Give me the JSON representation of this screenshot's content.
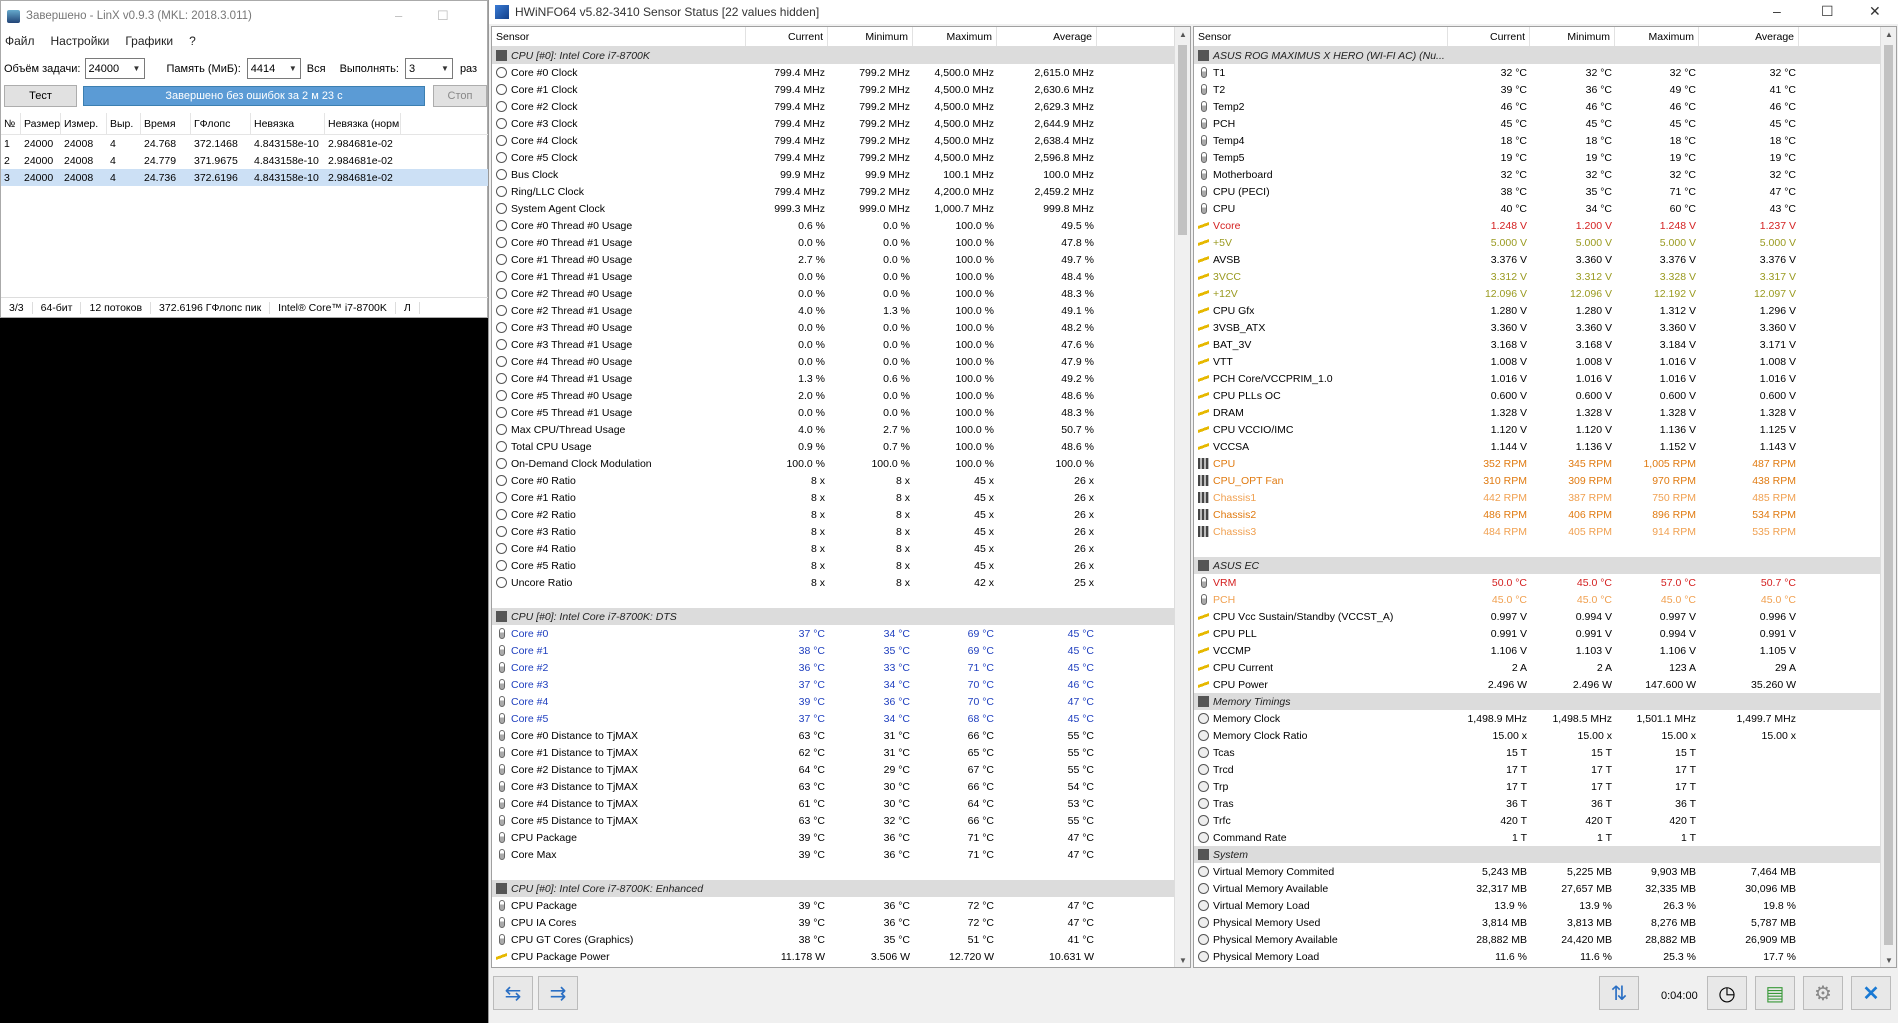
{
  "linx": {
    "title": "Завершено - LinX v0.9.3 (MKL: 2018.3.011)",
    "menu": [
      "Файл",
      "Настройки",
      "Графики",
      "?"
    ],
    "task_label": "Объём задачи:",
    "task_value": "24000",
    "mem_label": "Память (МиБ):",
    "mem_value": "4414",
    "all_label": "Вся",
    "run_label": "Выполнять:",
    "run_value": "3",
    "times_label": "раз",
    "test_button": "Тест",
    "status": "Завершено без ошибок за 2 м 23 с",
    "stop_button": "Стоп",
    "columns": [
      "№",
      "Размер",
      "Измер.",
      "Выр.",
      "Время",
      "ГФлопс",
      "Невязка",
      "Невязка (норм.)"
    ],
    "rows": [
      [
        "1",
        "24000",
        "24008",
        "4",
        "24.768",
        "372.1468",
        "4.843158e-10",
        "2.984681e-02"
      ],
      [
        "2",
        "24000",
        "24008",
        "4",
        "24.779",
        "371.9675",
        "4.843158e-10",
        "2.984681e-02"
      ],
      [
        "3",
        "24000",
        "24008",
        "4",
        "24.736",
        "372.6196",
        "4.843158e-10",
        "2.984681e-02"
      ]
    ],
    "footer": [
      "3/3",
      "64-бит",
      "12 потоков",
      "372.6196 ГФлопс пик",
      "Intel® Core™ i7-8700K",
      "Л"
    ]
  },
  "hw": {
    "title": "HWiNFO64 v5.82-3410 Sensor Status [22 values hidden]",
    "headers": [
      "Sensor",
      "Current",
      "Minimum",
      "Maximum",
      "Average"
    ],
    "timer": "0:04:00",
    "left": [
      {
        "g": "CPU [#0]: Intel Core i7-8700K"
      },
      {
        "i": "clk",
        "n": "Core #0 Clock",
        "v": [
          "799.4 MHz",
          "799.2 MHz",
          "4,500.0 MHz",
          "2,615.0 MHz"
        ]
      },
      {
        "i": "clk",
        "n": "Core #1 Clock",
        "v": [
          "799.4 MHz",
          "799.2 MHz",
          "4,500.0 MHz",
          "2,630.6 MHz"
        ]
      },
      {
        "i": "clk",
        "n": "Core #2 Clock",
        "v": [
          "799.4 MHz",
          "799.2 MHz",
          "4,500.0 MHz",
          "2,629.3 MHz"
        ]
      },
      {
        "i": "clk",
        "n": "Core #3 Clock",
        "v": [
          "799.4 MHz",
          "799.2 MHz",
          "4,500.0 MHz",
          "2,644.9 MHz"
        ]
      },
      {
        "i": "clk",
        "n": "Core #4 Clock",
        "v": [
          "799.4 MHz",
          "799.2 MHz",
          "4,500.0 MHz",
          "2,638.4 MHz"
        ]
      },
      {
        "i": "clk",
        "n": "Core #5 Clock",
        "v": [
          "799.4 MHz",
          "799.2 MHz",
          "4,500.0 MHz",
          "2,596.8 MHz"
        ]
      },
      {
        "i": "clk",
        "n": "Bus Clock",
        "v": [
          "99.9 MHz",
          "99.9 MHz",
          "100.1 MHz",
          "100.0 MHz"
        ]
      },
      {
        "i": "clk",
        "n": "Ring/LLC Clock",
        "v": [
          "799.4 MHz",
          "799.2 MHz",
          "4,200.0 MHz",
          "2,459.2 MHz"
        ]
      },
      {
        "i": "clk",
        "n": "System Agent Clock",
        "v": [
          "999.3 MHz",
          "999.0 MHz",
          "1,000.7 MHz",
          "999.8 MHz"
        ]
      },
      {
        "i": "clk",
        "n": "Core #0 Thread #0 Usage",
        "v": [
          "0.6 %",
          "0.0 %",
          "100.0 %",
          "49.5 %"
        ]
      },
      {
        "i": "clk",
        "n": "Core #0 Thread #1 Usage",
        "v": [
          "0.0 %",
          "0.0 %",
          "100.0 %",
          "47.8 %"
        ]
      },
      {
        "i": "clk",
        "n": "Core #1 Thread #0 Usage",
        "v": [
          "2.7 %",
          "0.0 %",
          "100.0 %",
          "49.7 %"
        ]
      },
      {
        "i": "clk",
        "n": "Core #1 Thread #1 Usage",
        "v": [
          "0.0 %",
          "0.0 %",
          "100.0 %",
          "48.4 %"
        ]
      },
      {
        "i": "clk",
        "n": "Core #2 Thread #0 Usage",
        "v": [
          "0.0 %",
          "0.0 %",
          "100.0 %",
          "48.3 %"
        ]
      },
      {
        "i": "clk",
        "n": "Core #2 Thread #1 Usage",
        "v": [
          "4.0 %",
          "1.3 %",
          "100.0 %",
          "49.1 %"
        ]
      },
      {
        "i": "clk",
        "n": "Core #3 Thread #0 Usage",
        "v": [
          "0.0 %",
          "0.0 %",
          "100.0 %",
          "48.2 %"
        ]
      },
      {
        "i": "clk",
        "n": "Core #3 Thread #1 Usage",
        "v": [
          "0.0 %",
          "0.0 %",
          "100.0 %",
          "47.6 %"
        ]
      },
      {
        "i": "clk",
        "n": "Core #4 Thread #0 Usage",
        "v": [
          "0.0 %",
          "0.0 %",
          "100.0 %",
          "47.9 %"
        ]
      },
      {
        "i": "clk",
        "n": "Core #4 Thread #1 Usage",
        "v": [
          "1.3 %",
          "0.6 %",
          "100.0 %",
          "49.2 %"
        ]
      },
      {
        "i": "clk",
        "n": "Core #5 Thread #0 Usage",
        "v": [
          "2.0 %",
          "0.0 %",
          "100.0 %",
          "48.6 %"
        ]
      },
      {
        "i": "clk",
        "n": "Core #5 Thread #1 Usage",
        "v": [
          "0.0 %",
          "0.0 %",
          "100.0 %",
          "48.3 %"
        ]
      },
      {
        "i": "clk",
        "n": "Max CPU/Thread Usage",
        "v": [
          "4.0 %",
          "2.7 %",
          "100.0 %",
          "50.7 %"
        ]
      },
      {
        "i": "clk",
        "n": "Total CPU Usage",
        "v": [
          "0.9 %",
          "0.7 %",
          "100.0 %",
          "48.6 %"
        ]
      },
      {
        "i": "clk",
        "n": "On-Demand Clock Modulation",
        "v": [
          "100.0 %",
          "100.0 %",
          "100.0 %",
          "100.0 %"
        ]
      },
      {
        "i": "clk",
        "n": "Core #0 Ratio",
        "v": [
          "8 x",
          "8 x",
          "45 x",
          "26 x"
        ]
      },
      {
        "i": "clk",
        "n": "Core #1 Ratio",
        "v": [
          "8 x",
          "8 x",
          "45 x",
          "26 x"
        ]
      },
      {
        "i": "clk",
        "n": "Core #2 Ratio",
        "v": [
          "8 x",
          "8 x",
          "45 x",
          "26 x"
        ]
      },
      {
        "i": "clk",
        "n": "Core #3 Ratio",
        "v": [
          "8 x",
          "8 x",
          "45 x",
          "26 x"
        ]
      },
      {
        "i": "clk",
        "n": "Core #4 Ratio",
        "v": [
          "8 x",
          "8 x",
          "45 x",
          "26 x"
        ]
      },
      {
        "i": "clk",
        "n": "Core #5 Ratio",
        "v": [
          "8 x",
          "8 x",
          "45 x",
          "26 x"
        ]
      },
      {
        "i": "clk",
        "n": "Uncore Ratio",
        "v": [
          "8 x",
          "8 x",
          "42 x",
          "25 x"
        ]
      },
      {
        "b": 1
      },
      {
        "g": "CPU [#0]: Intel Core i7-8700K: DTS"
      },
      {
        "i": "tmp",
        "n": "Core #0",
        "c": "#1f3fbf",
        "v": [
          "37 °C",
          "34 °C",
          "69 °C",
          "45 °C"
        ]
      },
      {
        "i": "tmp",
        "n": "Core #1",
        "c": "#1f3fbf",
        "v": [
          "38 °C",
          "35 °C",
          "69 °C",
          "45 °C"
        ]
      },
      {
        "i": "tmp",
        "n": "Core #2",
        "c": "#1f3fbf",
        "v": [
          "36 °C",
          "33 °C",
          "71 °C",
          "45 °C"
        ]
      },
      {
        "i": "tmp",
        "n": "Core #3",
        "c": "#1f3fbf",
        "v": [
          "37 °C",
          "34 °C",
          "70 °C",
          "46 °C"
        ]
      },
      {
        "i": "tmp",
        "n": "Core #4",
        "c": "#1f3fbf",
        "v": [
          "39 °C",
          "36 °C",
          "70 °C",
          "47 °C"
        ]
      },
      {
        "i": "tmp",
        "n": "Core #5",
        "c": "#1f3fbf",
        "v": [
          "37 °C",
          "34 °C",
          "68 °C",
          "45 °C"
        ]
      },
      {
        "i": "tmp",
        "n": "Core #0 Distance to TjMAX",
        "v": [
          "63 °C",
          "31 °C",
          "66 °C",
          "55 °C"
        ]
      },
      {
        "i": "tmp",
        "n": "Core #1 Distance to TjMAX",
        "v": [
          "62 °C",
          "31 °C",
          "65 °C",
          "55 °C"
        ]
      },
      {
        "i": "tmp",
        "n": "Core #2 Distance to TjMAX",
        "v": [
          "64 °C",
          "29 °C",
          "67 °C",
          "55 °C"
        ]
      },
      {
        "i": "tmp",
        "n": "Core #3 Distance to TjMAX",
        "v": [
          "63 °C",
          "30 °C",
          "66 °C",
          "54 °C"
        ]
      },
      {
        "i": "tmp",
        "n": "Core #4 Distance to TjMAX",
        "v": [
          "61 °C",
          "30 °C",
          "64 °C",
          "53 °C"
        ]
      },
      {
        "i": "tmp",
        "n": "Core #5 Distance to TjMAX",
        "v": [
          "63 °C",
          "32 °C",
          "66 °C",
          "55 °C"
        ]
      },
      {
        "i": "tmp",
        "n": "CPU Package",
        "v": [
          "39 °C",
          "36 °C",
          "71 °C",
          "47 °C"
        ]
      },
      {
        "i": "tmp",
        "n": "Core Max",
        "v": [
          "39 °C",
          "36 °C",
          "71 °C",
          "47 °C"
        ]
      },
      {
        "b": 1
      },
      {
        "g": "CPU [#0]: Intel Core i7-8700K: Enhanced"
      },
      {
        "i": "tmp",
        "n": "CPU Package",
        "v": [
          "39 °C",
          "36 °C",
          "72 °C",
          "47 °C"
        ]
      },
      {
        "i": "tmp",
        "n": "CPU IA Cores",
        "v": [
          "39 °C",
          "36 °C",
          "72 °C",
          "47 °C"
        ]
      },
      {
        "i": "tmp",
        "n": "CPU GT Cores (Graphics)",
        "v": [
          "38 °C",
          "35 °C",
          "51 °C",
          "41 °C"
        ]
      },
      {
        "i": "volt",
        "n": "CPU Package Power",
        "v": [
          "11.178 W",
          "3.506 W",
          "12.720 W",
          "10.631 W"
        ]
      }
    ],
    "right": [
      {
        "g": "ASUS ROG MAXIMUS X HERO (WI-FI AC) (Nu..."
      },
      {
        "i": "tmp",
        "n": "T1",
        "v": [
          "32 °C",
          "32 °C",
          "32 °C",
          "32 °C"
        ]
      },
      {
        "i": "tmp",
        "n": "T2",
        "v": [
          "39 °C",
          "36 °C",
          "49 °C",
          "41 °C"
        ]
      },
      {
        "i": "tmp",
        "n": "Temp2",
        "v": [
          "46 °C",
          "46 °C",
          "46 °C",
          "46 °C"
        ]
      },
      {
        "i": "tmp",
        "n": "PCH",
        "v": [
          "45 °C",
          "45 °C",
          "45 °C",
          "45 °C"
        ]
      },
      {
        "i": "tmp",
        "n": "Temp4",
        "v": [
          "18 °C",
          "18 °C",
          "18 °C",
          "18 °C"
        ]
      },
      {
        "i": "tmp",
        "n": "Temp5",
        "v": [
          "19 °C",
          "19 °C",
          "19 °C",
          "19 °C"
        ]
      },
      {
        "i": "tmp",
        "n": "Motherboard",
        "v": [
          "32 °C",
          "32 °C",
          "32 °C",
          "32 °C"
        ]
      },
      {
        "i": "tmp",
        "n": "CPU (PECI)",
        "v": [
          "38 °C",
          "35 °C",
          "71 °C",
          "47 °C"
        ]
      },
      {
        "i": "tmp",
        "n": "CPU",
        "v": [
          "40 °C",
          "34 °C",
          "60 °C",
          "43 °C"
        ]
      },
      {
        "i": "volt",
        "n": "Vcore",
        "c": "#d42020",
        "v": [
          "1.248 V",
          "1.200 V",
          "1.248 V",
          "1.237 V"
        ]
      },
      {
        "i": "volt",
        "n": "+5V",
        "c": "#9a9a20",
        "v": [
          "5.000 V",
          "5.000 V",
          "5.000 V",
          "5.000 V"
        ]
      },
      {
        "i": "volt",
        "n": "AVSB",
        "v": [
          "3.376 V",
          "3.360 V",
          "3.376 V",
          "3.376 V"
        ]
      },
      {
        "i": "volt",
        "n": "3VCC",
        "c": "#9a9a20",
        "v": [
          "3.312 V",
          "3.312 V",
          "3.328 V",
          "3.317 V"
        ]
      },
      {
        "i": "volt",
        "n": "+12V",
        "c": "#9a9a20",
        "v": [
          "12.096 V",
          "12.096 V",
          "12.192 V",
          "12.097 V"
        ]
      },
      {
        "i": "volt",
        "n": "CPU Gfx",
        "v": [
          "1.280 V",
          "1.280 V",
          "1.312 V",
          "1.296 V"
        ]
      },
      {
        "i": "volt",
        "n": "3VSB_ATX",
        "v": [
          "3.360 V",
          "3.360 V",
          "3.360 V",
          "3.360 V"
        ]
      },
      {
        "i": "volt",
        "n": "BAT_3V",
        "v": [
          "3.168 V",
          "3.168 V",
          "3.184 V",
          "3.171 V"
        ]
      },
      {
        "i": "volt",
        "n": "VTT",
        "v": [
          "1.008 V",
          "1.008 V",
          "1.016 V",
          "1.008 V"
        ]
      },
      {
        "i": "volt",
        "n": "PCH Core/VCCPRIM_1.0",
        "v": [
          "1.016 V",
          "1.016 V",
          "1.016 V",
          "1.016 V"
        ]
      },
      {
        "i": "volt",
        "n": "CPU PLLs OC",
        "v": [
          "0.600 V",
          "0.600 V",
          "0.600 V",
          "0.600 V"
        ]
      },
      {
        "i": "volt",
        "n": "DRAM",
        "v": [
          "1.328 V",
          "1.328 V",
          "1.328 V",
          "1.328 V"
        ]
      },
      {
        "i": "volt",
        "n": "CPU VCCIO/IMC",
        "v": [
          "1.120 V",
          "1.120 V",
          "1.136 V",
          "1.125 V"
        ]
      },
      {
        "i": "volt",
        "n": "VCCSA",
        "v": [
          "1.144 V",
          "1.136 V",
          "1.152 V",
          "1.143 V"
        ]
      },
      {
        "i": "fan",
        "n": "CPU",
        "c": "#e07a10",
        "v": [
          "352 RPM",
          "345 RPM",
          "1,005 RPM",
          "487 RPM"
        ]
      },
      {
        "i": "fan",
        "n": "CPU_OPT Fan",
        "c": "#e07a10",
        "v": [
          "310 RPM",
          "309 RPM",
          "970 RPM",
          "438 RPM"
        ]
      },
      {
        "i": "fan",
        "n": "Chassis1",
        "c": "#f0a050",
        "v": [
          "442 RPM",
          "387 RPM",
          "750 RPM",
          "485 RPM"
        ]
      },
      {
        "i": "fan",
        "n": "Chassis2",
        "c": "#e07a10",
        "v": [
          "486 RPM",
          "406 RPM",
          "896 RPM",
          "534 RPM"
        ]
      },
      {
        "i": "fan",
        "n": "Chassis3",
        "c": "#f0a050",
        "v": [
          "484 RPM",
          "405 RPM",
          "914 RPM",
          "535 RPM"
        ]
      },
      {
        "b": 1
      },
      {
        "g": "ASUS EC"
      },
      {
        "i": "tmp",
        "n": "VRM",
        "c": "#d42020",
        "v": [
          "50.0 °C",
          "45.0 °C",
          "57.0 °C",
          "50.7 °C"
        ]
      },
      {
        "i": "tmp",
        "n": "PCH",
        "c": "#f0a050",
        "v": [
          "45.0 °C",
          "45.0 °C",
          "45.0 °C",
          "45.0 °C"
        ]
      },
      {
        "i": "volt",
        "n": "CPU Vcc Sustain/Standby (VCCST_A)",
        "v": [
          "0.997 V",
          "0.994 V",
          "0.997 V",
          "0.996 V"
        ]
      },
      {
        "i": "volt",
        "n": "CPU PLL",
        "v": [
          "0.991 V",
          "0.991 V",
          "0.994 V",
          "0.991 V"
        ]
      },
      {
        "i": "volt",
        "n": "VCCMP",
        "v": [
          "1.106 V",
          "1.103 V",
          "1.106 V",
          "1.105 V"
        ]
      },
      {
        "i": "volt",
        "n": "CPU Current",
        "v": [
          "2 A",
          "2 A",
          "123 A",
          "29 A"
        ]
      },
      {
        "i": "volt",
        "n": "CPU Power",
        "v": [
          "2.496 W",
          "2.496 W",
          "147.600 W",
          "35.260 W"
        ]
      },
      {
        "g": "Memory Timings"
      },
      {
        "i": "mem",
        "n": "Memory Clock",
        "v": [
          "1,498.9 MHz",
          "1,498.5 MHz",
          "1,501.1 MHz",
          "1,499.7 MHz"
        ]
      },
      {
        "i": "mem",
        "n": "Memory Clock Ratio",
        "v": [
          "15.00 x",
          "15.00 x",
          "15.00 x",
          "15.00 x"
        ]
      },
      {
        "i": "mem",
        "n": "Tcas",
        "v": [
          "15 T",
          "15 T",
          "15 T",
          ""
        ]
      },
      {
        "i": "mem",
        "n": "Trcd",
        "v": [
          "17 T",
          "17 T",
          "17 T",
          ""
        ]
      },
      {
        "i": "mem",
        "n": "Trp",
        "v": [
          "17 T",
          "17 T",
          "17 T",
          ""
        ]
      },
      {
        "i": "mem",
        "n": "Tras",
        "v": [
          "36 T",
          "36 T",
          "36 T",
          ""
        ]
      },
      {
        "i": "mem",
        "n": "Trfc",
        "v": [
          "420 T",
          "420 T",
          "420 T",
          ""
        ]
      },
      {
        "i": "mem",
        "n": "Command Rate",
        "v": [
          "1 T",
          "1 T",
          "1 T",
          ""
        ]
      },
      {
        "g": "System"
      },
      {
        "i": "mem",
        "n": "Virtual Memory Commited",
        "v": [
          "5,243 MB",
          "5,225 MB",
          "9,903 MB",
          "7,464 MB"
        ]
      },
      {
        "i": "mem",
        "n": "Virtual Memory Available",
        "v": [
          "32,317 MB",
          "27,657 MB",
          "32,335 MB",
          "30,096 MB"
        ]
      },
      {
        "i": "mem",
        "n": "Virtual Memory Load",
        "v": [
          "13.9 %",
          "13.9 %",
          "26.3 %",
          "19.8 %"
        ]
      },
      {
        "i": "mem",
        "n": "Physical Memory Used",
        "v": [
          "3,814 MB",
          "3,813 MB",
          "8,276 MB",
          "5,787 MB"
        ]
      },
      {
        "i": "mem",
        "n": "Physical Memory Available",
        "v": [
          "28,882 MB",
          "24,420 MB",
          "28,882 MB",
          "26,909 MB"
        ]
      },
      {
        "i": "mem",
        "n": "Physical Memory Load",
        "v": [
          "11.6 %",
          "11.6 %",
          "25.3 %",
          "17.7 %"
        ]
      }
    ]
  }
}
